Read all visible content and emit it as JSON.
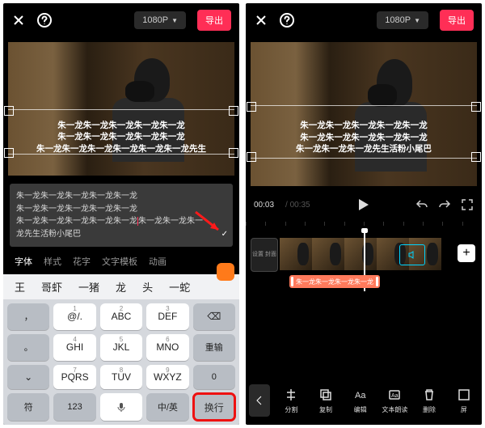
{
  "common": {
    "resolution": "1080P",
    "export": "导出"
  },
  "left": {
    "overlay": {
      "l1": "朱一龙朱一龙朱一龙朱一龙朱一龙",
      "l2": "朱一龙朱一龙朱一龙朱一龙朱一龙",
      "l3": "朱一龙朱一龙朱一龙朱一龙朱一龙朱一龙先生"
    },
    "editbox": {
      "l1": "朱一龙朱一龙朱一龙朱一龙朱一龙",
      "l2": "朱一龙朱一龙朱一龙朱一龙朱一龙",
      "l3a": "朱一龙朱一龙朱一龙朱一龙朱一龙",
      "l3b": "朱一龙朱一龙朱一",
      "l4": "龙先生活粉小尾巴"
    },
    "tabs": [
      "字体",
      "样式",
      "花字",
      "文字模板",
      "动画"
    ],
    "candidates": [
      "王",
      "哥虾",
      "一猪",
      "龙",
      "头",
      "一蛇"
    ],
    "keys": {
      "r1": [
        "@/.",
        "ABC",
        "DEF"
      ],
      "r2": [
        "GHI",
        "JKL",
        "MNO"
      ],
      "r3": [
        "PQRS",
        "TUV",
        "WXYZ"
      ],
      "nums": [
        "1",
        "2",
        "3",
        "4",
        "5",
        "6",
        "7",
        "8",
        "9"
      ],
      "backspace": "⌫",
      "reinput": "重输",
      "zero": "0",
      "symbol": "符",
      "number": "123",
      "space": "",
      "zh": "中/英",
      "enter": "换行",
      "comma1": "，",
      "comma2": "。"
    }
  },
  "right": {
    "overlay": {
      "l1": "朱一龙朱一龙朱一龙朱一龙朱一龙",
      "l2": "朱一龙朱一龙朱一龙朱一龙朱一龙",
      "l3": "朱一龙朱一龙朱一龙先生活粉小尾巴"
    },
    "time": {
      "cur": "00:03",
      "dur": "/ 00:35"
    },
    "coverbtn": "设置\n封面",
    "textclip": "朱一龙朱一龙朱一龙朱一龙",
    "bottombar": [
      "分割",
      "复制",
      "编辑",
      "文本朗读",
      "删除",
      "屏"
    ]
  }
}
